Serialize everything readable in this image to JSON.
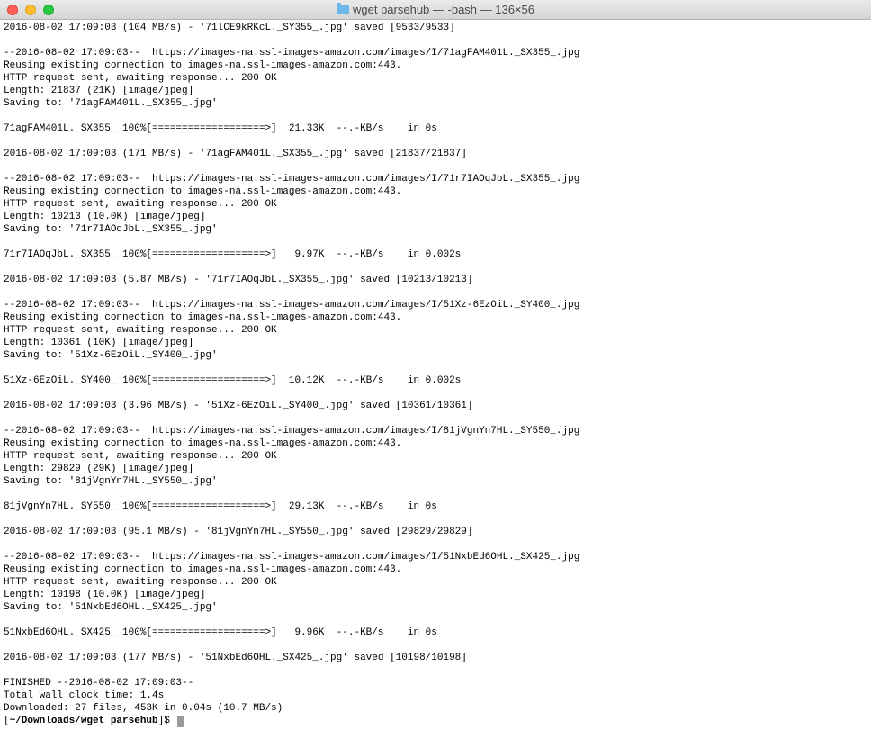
{
  "titlebar": {
    "title": "wget parsehub — -bash — 136×56"
  },
  "lines": [
    "2016-08-02 17:09:03 (104 MB/s) - '71lCE9kRKcL._SY355_.jpg' saved [9533/9533]",
    "",
    "--2016-08-02 17:09:03--  https://images-na.ssl-images-amazon.com/images/I/71agFAM401L._SX355_.jpg",
    "Reusing existing connection to images-na.ssl-images-amazon.com:443.",
    "HTTP request sent, awaiting response... 200 OK",
    "Length: 21837 (21K) [image/jpeg]",
    "Saving to: '71agFAM401L._SX355_.jpg'",
    "",
    "71agFAM401L._SX355_ 100%[===================>]  21.33K  --.-KB/s    in 0s",
    "",
    "2016-08-02 17:09:03 (171 MB/s) - '71agFAM401L._SX355_.jpg' saved [21837/21837]",
    "",
    "--2016-08-02 17:09:03--  https://images-na.ssl-images-amazon.com/images/I/71r7IAOqJbL._SX355_.jpg",
    "Reusing existing connection to images-na.ssl-images-amazon.com:443.",
    "HTTP request sent, awaiting response... 200 OK",
    "Length: 10213 (10.0K) [image/jpeg]",
    "Saving to: '71r7IAOqJbL._SX355_.jpg'",
    "",
    "71r7IAOqJbL._SX355_ 100%[===================>]   9.97K  --.-KB/s    in 0.002s",
    "",
    "2016-08-02 17:09:03 (5.87 MB/s) - '71r7IAOqJbL._SX355_.jpg' saved [10213/10213]",
    "",
    "--2016-08-02 17:09:03--  https://images-na.ssl-images-amazon.com/images/I/51Xz-6EzOiL._SY400_.jpg",
    "Reusing existing connection to images-na.ssl-images-amazon.com:443.",
    "HTTP request sent, awaiting response... 200 OK",
    "Length: 10361 (10K) [image/jpeg]",
    "Saving to: '51Xz-6EzOiL._SY400_.jpg'",
    "",
    "51Xz-6EzOiL._SY400_ 100%[===================>]  10.12K  --.-KB/s    in 0.002s",
    "",
    "2016-08-02 17:09:03 (3.96 MB/s) - '51Xz-6EzOiL._SY400_.jpg' saved [10361/10361]",
    "",
    "--2016-08-02 17:09:03--  https://images-na.ssl-images-amazon.com/images/I/81jVgnYn7HL._SY550_.jpg",
    "Reusing existing connection to images-na.ssl-images-amazon.com:443.",
    "HTTP request sent, awaiting response... 200 OK",
    "Length: 29829 (29K) [image/jpeg]",
    "Saving to: '81jVgnYn7HL._SY550_.jpg'",
    "",
    "81jVgnYn7HL._SY550_ 100%[===================>]  29.13K  --.-KB/s    in 0s",
    "",
    "2016-08-02 17:09:03 (95.1 MB/s) - '81jVgnYn7HL._SY550_.jpg' saved [29829/29829]",
    "",
    "--2016-08-02 17:09:03--  https://images-na.ssl-images-amazon.com/images/I/51NxbEd6OHL._SX425_.jpg",
    "Reusing existing connection to images-na.ssl-images-amazon.com:443.",
    "HTTP request sent, awaiting response... 200 OK",
    "Length: 10198 (10.0K) [image/jpeg]",
    "Saving to: '51NxbEd6OHL._SX425_.jpg'",
    "",
    "51NxbEd6OHL._SX425_ 100%[===================>]   9.96K  --.-KB/s    in 0s",
    "",
    "2016-08-02 17:09:03 (177 MB/s) - '51NxbEd6OHL._SX425_.jpg' saved [10198/10198]",
    "",
    "FINISHED --2016-08-02 17:09:03--",
    "Total wall clock time: 1.4s",
    "Downloaded: 27 files, 453K in 0.04s (10.7 MB/s)"
  ],
  "prompt": {
    "open": "[",
    "path": "~/Downloads/wget parsehub",
    "close": "]$ "
  }
}
